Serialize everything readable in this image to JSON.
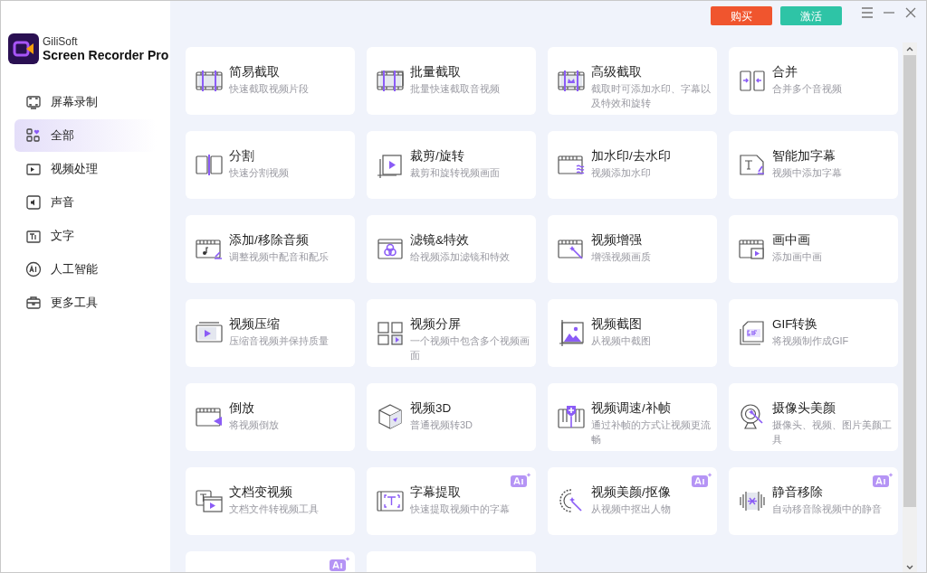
{
  "app": {
    "brand": "GiliSoft",
    "product": "Screen Recorder Pro"
  },
  "header_buttons": [
    {
      "label": "购买",
      "kind": "buy"
    },
    {
      "label": "激活",
      "kind": "activate"
    }
  ],
  "sidebar": {
    "items": [
      {
        "label": "屏幕录制",
        "selected": false
      },
      {
        "label": "全部",
        "selected": true
      },
      {
        "label": "视频处理",
        "selected": false
      },
      {
        "label": "声音",
        "selected": false
      },
      {
        "label": "文字",
        "selected": false
      },
      {
        "label": "人工智能",
        "selected": false
      },
      {
        "label": "更多工具",
        "selected": false
      }
    ]
  },
  "tools": [
    {
      "title": "简易截取",
      "description": "快速截取视频片段",
      "ai": false
    },
    {
      "title": "批量截取",
      "description": "批量快速截取音视频",
      "ai": false
    },
    {
      "title": "高级截取",
      "description": "截取时可添加水印、字幕以及特效和旋转",
      "ai": false
    },
    {
      "title": "合并",
      "description": "合并多个音视频",
      "ai": false
    },
    {
      "title": "分割",
      "description": "快速分割视频",
      "ai": false
    },
    {
      "title": "裁剪/旋转",
      "description": "裁剪和旋转视频画面",
      "ai": false
    },
    {
      "title": "加水印/去水印",
      "description": "视频添加水印",
      "ai": false
    },
    {
      "title": "智能加字幕",
      "description": "视频中添加字幕",
      "ai": false
    },
    {
      "title": "添加/移除音频",
      "description": "调整视频中配音和配乐",
      "ai": false
    },
    {
      "title": "滤镜&特效",
      "description": "给视频添加滤镜和特效",
      "ai": false
    },
    {
      "title": "视频增强",
      "description": "增强视频画质",
      "ai": false
    },
    {
      "title": "画中画",
      "description": "添加画中画",
      "ai": false
    },
    {
      "title": "视频压缩",
      "description": "压缩音视频并保持质量",
      "ai": false
    },
    {
      "title": "视频分屏",
      "description": "一个视频中包含多个视频画面",
      "ai": false
    },
    {
      "title": "视频截图",
      "description": "从视频中截图",
      "ai": false
    },
    {
      "title": "GIF转换",
      "description": "将视频制作成GIF",
      "ai": false
    },
    {
      "title": "倒放",
      "description": "将视频倒放",
      "ai": false
    },
    {
      "title": "视频3D",
      "description": "普通视频转3D",
      "ai": false
    },
    {
      "title": "视频调速/补帧",
      "description": "通过补帧的方式让视频更流畅",
      "ai": false
    },
    {
      "title": "摄像头美颜",
      "description": "摄像头、视频、图片美颜工具",
      "ai": false
    },
    {
      "title": "文档变视频",
      "description": "文档文件转视频工具",
      "ai": false
    },
    {
      "title": "字幕提取",
      "description": "快速提取视频中的字幕",
      "ai": true
    },
    {
      "title": "视频美颜/抠像",
      "description": "从视频中抠出人物",
      "ai": true
    },
    {
      "title": "静音移除",
      "description": "自动移音除视频中的静音",
      "ai": true
    },
    {
      "ai": true
    },
    {
      "ai": false
    }
  ]
}
